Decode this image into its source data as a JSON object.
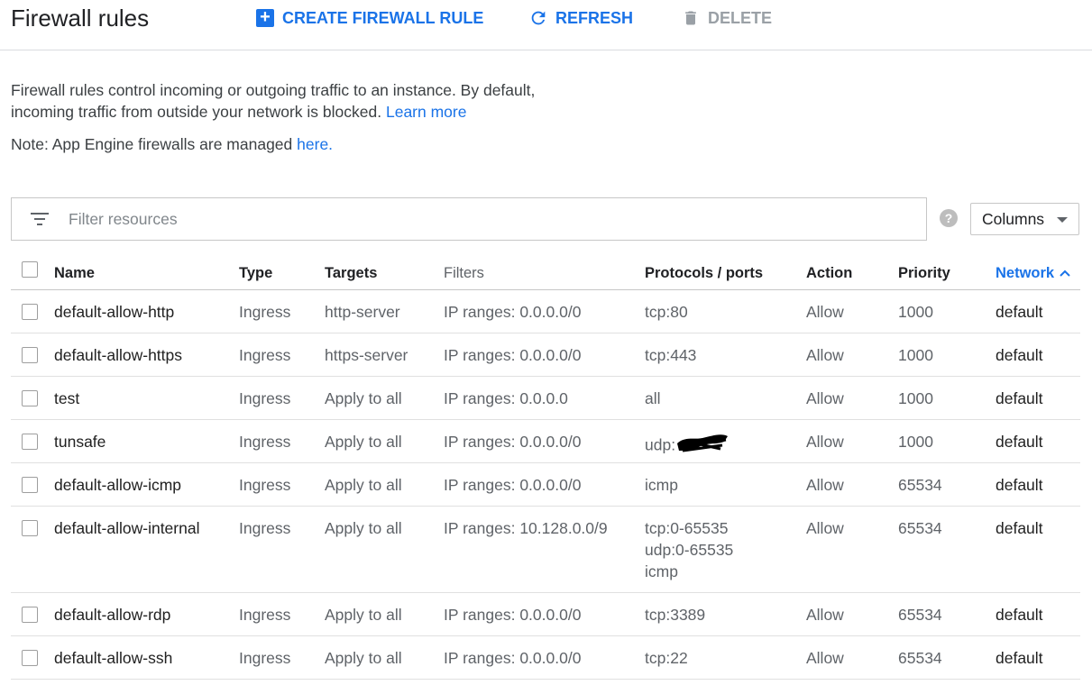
{
  "header": {
    "title": "Firewall rules",
    "create_label": "CREATE FIREWALL RULE",
    "refresh_label": "REFRESH",
    "delete_label": "DELETE"
  },
  "intro": {
    "line1": "Firewall rules control incoming or outgoing traffic to an instance. By default,",
    "line2": "incoming traffic from outside your network is blocked.",
    "learn_more": "Learn more",
    "note_prefix": "Note: App Engine firewalls are managed",
    "note_link": "here."
  },
  "filter": {
    "placeholder": "Filter resources"
  },
  "help_label": "?",
  "columns_label": "Columns",
  "table": {
    "headers": {
      "name": "Name",
      "type": "Type",
      "targets": "Targets",
      "filters": "Filters",
      "protocols": "Protocols / ports",
      "action": "Action",
      "priority": "Priority",
      "network": "Network"
    },
    "rows": [
      {
        "name": "default-allow-http",
        "type": "Ingress",
        "targets": "http-server",
        "filters": "IP ranges: 0.0.0.0/0",
        "protocols": [
          "tcp:80"
        ],
        "action": "Allow",
        "priority": "1000",
        "network": "default"
      },
      {
        "name": "default-allow-https",
        "type": "Ingress",
        "targets": "https-server",
        "filters": "IP ranges: 0.0.0.0/0",
        "protocols": [
          "tcp:443"
        ],
        "action": "Allow",
        "priority": "1000",
        "network": "default"
      },
      {
        "name": "test",
        "type": "Ingress",
        "targets": "Apply to all",
        "filters": "IP ranges: 0.0.0.0",
        "protocols": [
          "all"
        ],
        "action": "Allow",
        "priority": "1000",
        "network": "default"
      },
      {
        "name": "tunsafe",
        "type": "Ingress",
        "targets": "Apply to all",
        "filters": "IP ranges: 0.0.0.0/0",
        "protocols": [
          "udp:"
        ],
        "action": "Allow",
        "priority": "1000",
        "network": "default",
        "redacted": true
      },
      {
        "name": "default-allow-icmp",
        "type": "Ingress",
        "targets": "Apply to all",
        "filters": "IP ranges: 0.0.0.0/0",
        "protocols": [
          "icmp"
        ],
        "action": "Allow",
        "priority": "65534",
        "network": "default"
      },
      {
        "name": "default-allow-internal",
        "type": "Ingress",
        "targets": "Apply to all",
        "filters": "IP ranges: 10.128.0.0/9",
        "protocols": [
          "tcp:0-65535",
          "udp:0-65535",
          "icmp"
        ],
        "action": "Allow",
        "priority": "65534",
        "network": "default"
      },
      {
        "name": "default-allow-rdp",
        "type": "Ingress",
        "targets": "Apply to all",
        "filters": "IP ranges: 0.0.0.0/0",
        "protocols": [
          "tcp:3389"
        ],
        "action": "Allow",
        "priority": "65534",
        "network": "default"
      },
      {
        "name": "default-allow-ssh",
        "type": "Ingress",
        "targets": "Apply to all",
        "filters": "IP ranges: 0.0.0.0/0",
        "protocols": [
          "tcp:22"
        ],
        "action": "Allow",
        "priority": "65534",
        "network": "default"
      }
    ]
  }
}
